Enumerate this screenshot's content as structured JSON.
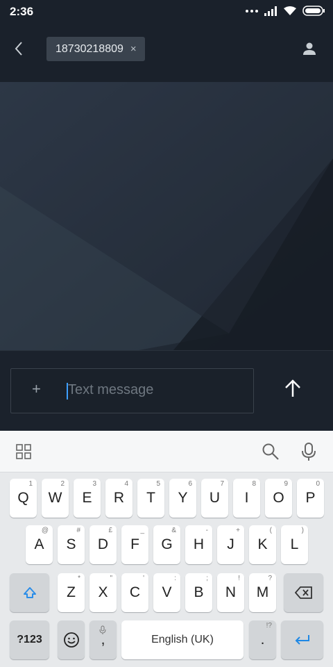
{
  "status": {
    "time": "2:36"
  },
  "header": {
    "recipient": "18730218809",
    "remove_symbol": "×"
  },
  "composer": {
    "placeholder": "Text message",
    "plus_symbol": "+"
  },
  "keyboard": {
    "row1": [
      {
        "k": "Q",
        "s": "1"
      },
      {
        "k": "W",
        "s": "2"
      },
      {
        "k": "E",
        "s": "3"
      },
      {
        "k": "R",
        "s": "4"
      },
      {
        "k": "T",
        "s": "5"
      },
      {
        "k": "Y",
        "s": "6"
      },
      {
        "k": "U",
        "s": "7"
      },
      {
        "k": "I",
        "s": "8"
      },
      {
        "k": "O",
        "s": "9"
      },
      {
        "k": "P",
        "s": "0"
      }
    ],
    "row2": [
      {
        "k": "A",
        "s": "@"
      },
      {
        "k": "S",
        "s": "#"
      },
      {
        "k": "D",
        "s": "£"
      },
      {
        "k": "F",
        "s": "_"
      },
      {
        "k": "G",
        "s": "&"
      },
      {
        "k": "H",
        "s": "-"
      },
      {
        "k": "J",
        "s": "+"
      },
      {
        "k": "K",
        "s": "("
      },
      {
        "k": "L",
        "s": ")"
      }
    ],
    "row3": [
      {
        "k": "Z",
        "s": "*"
      },
      {
        "k": "X",
        "s": "\""
      },
      {
        "k": "C",
        "s": "'"
      },
      {
        "k": "V",
        "s": ":"
      },
      {
        "k": "B",
        "s": ";"
      },
      {
        "k": "N",
        "s": "!"
      },
      {
        "k": "M",
        "s": "?"
      }
    ],
    "symbols_key": "?123",
    "comma": ",",
    "space_label": "English (UK)",
    "period": ".",
    "period_sub": "!?"
  },
  "colors": {
    "accent": "#3ea0ff",
    "enter": "#1e88e5"
  },
  "icons": [
    "back-arrow-icon",
    "contact-icon",
    "send-arrow-icon",
    "apps-grid-icon",
    "search-icon",
    "microphone-icon",
    "shift-icon",
    "backspace-icon",
    "emoji-icon",
    "enter-icon"
  ]
}
